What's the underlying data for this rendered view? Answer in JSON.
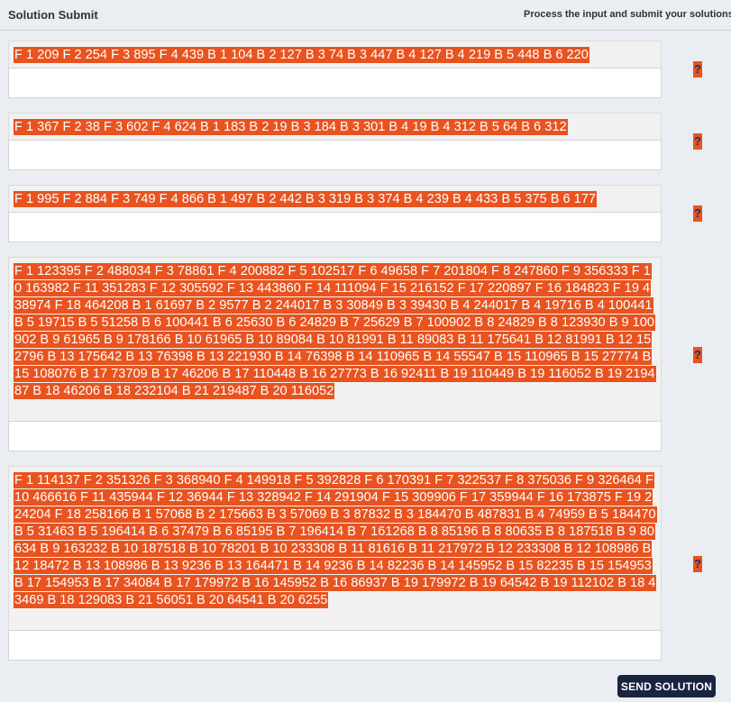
{
  "header": {
    "title": "Solution Submit",
    "subtitle": "Process the input and submit your solutions"
  },
  "tasks": [
    {
      "text": "F 1 209 F 2 254 F 3 895 F 4 439 B 1 104 B 2 127 B 3 74 B 3 447 B 4 127 B 4 219 B 5 448 B 6 220",
      "answer": "",
      "help": "?"
    },
    {
      "text": "F 1 367 F 2 38 F 3 602 F 4 624 B 1 183 B 2 19 B 3 184 B 3 301 B 4 19 B 4 312 B 5 64 B 6 312",
      "answer": "",
      "help": "?"
    },
    {
      "text": "F 1 995 F 2 884 F 3 749 F 4 866 B 1 497 B 2 442 B 3 319 B 3 374 B 4 239 B 4 433 B 5 375 B 6 177",
      "answer": "",
      "help": "?"
    },
    {
      "text": "F 1 123395 F 2 488034 F 3 78861 F 4 200882 F 5 102517 F 6 49658 F 7 201804 F 8 247860 F 9 356333 F 10 163982 F 11 351283 F 12 305592 F 13 443860 F 14 111094 F 15 216152 F 17 220897 F 16 184823 F 19 438974 F 18 464208 B 1 61697 B 2 9577 B 2 244017 B 3 30849 B 3 39430 B 4 244017 B 4 19716 B 4 100441 B 5 19715 B 5 51258 B 6 100441 B 6 25630 B 6 24829 B 7 25629 B 7 100902 B 8 24829 B 8 123930 B 9 100902 B 9 61965 B 9 178166 B 10 61965 B 10 89084 B 10 81991 B 11 89083 B 11 175641 B 12 81991 B 12 152796 B 13 175642 B 13 76398 B 13 221930 B 14 76398 B 14 110965 B 14 55547 B 15 110965 B 15 27774 B 15 108076 B 17 73709 B 17 46206 B 17 110448 B 16 27773 B 16 92411 B 19 110449 B 19 116052 B 19 219487 B 18 46206 B 18 232104 B 21 219487 B 20 116052",
      "answer": "",
      "help": "?"
    },
    {
      "text": "F 1 114137 F 2 351326 F 3 368940 F 4 149918 F 5 392828 F 6 170391 F 7 322537 F 8 375036 F 9 326464 F 10 466616 F 11 435944 F 12 36944 F 13 328942 F 14 291904 F 15 309906 F 17 359944 F 16 173875 F 19 224204 F 18 258166 B 1 57068 B 2 175663 B 3 57069 B 3 87832 B 3 184470 B 487831 B 4 74959 B 5 184470 B 5 31463 B 5 196414 B 6 37479 B 6 85195 B 7 196414 B 7 161268 B 8 85196 B 8 80635 B 8 187518 B 9 80634 B 9 163232 B 10 187518 B 10 78201 B 10 233308 B 11 81616 B 11 217972 B 12 233308 B 12 108986 B 12 18472 B 13 108986 B 13 9236 B 13 164471 B 14 9236 B 14 82236 B 14 145952 B 15 82235 B 15 154953 B 17 154953 B 17 34084 B 17 179972 B 16 145952 B 16 86937 B 19 179972 B 19 64542 B 19 112102 B 18 43469 B 18 129083 B 21 56051 B 20 64541 B 20 6255",
      "answer": "",
      "help": "?"
    }
  ],
  "send_button": "SEND SOLUTION"
}
